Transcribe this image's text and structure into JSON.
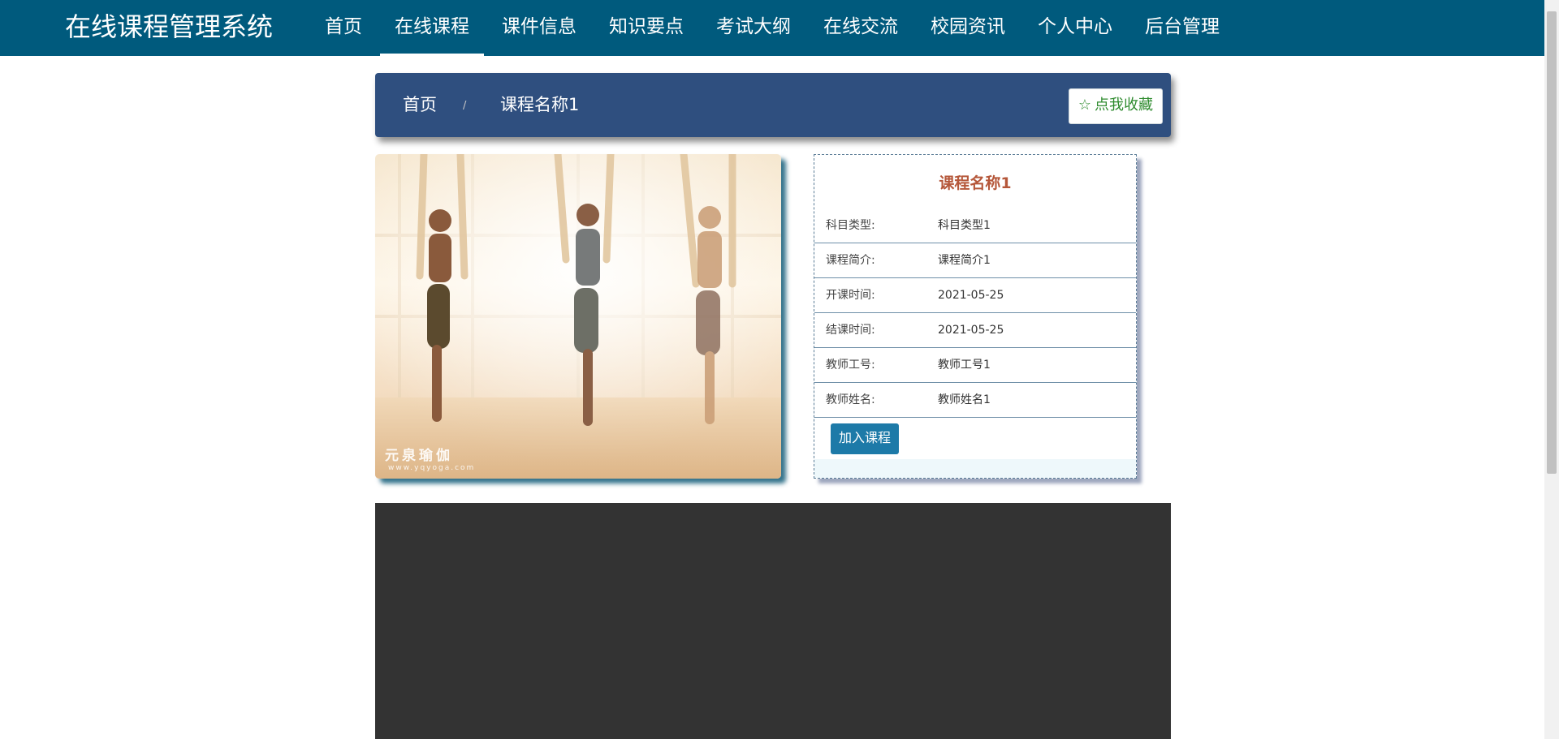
{
  "header": {
    "site_title": "在线课程管理系统",
    "nav": [
      {
        "label": "首页",
        "active": false
      },
      {
        "label": "在线课程",
        "active": true
      },
      {
        "label": "课件信息",
        "active": false
      },
      {
        "label": "知识要点",
        "active": false
      },
      {
        "label": "考试大纲",
        "active": false
      },
      {
        "label": "在线交流",
        "active": false
      },
      {
        "label": "校园资讯",
        "active": false
      },
      {
        "label": "个人中心",
        "active": false
      },
      {
        "label": "后台管理",
        "active": false
      }
    ]
  },
  "breadcrumb": {
    "home": "首页",
    "separator": "/",
    "current": "课程名称1",
    "favorite_label": "点我收藏",
    "favorite_icon": "star-outline-icon"
  },
  "course_image": {
    "watermark": "元泉瑜伽",
    "watermark_sub": "www.yqyoga.com"
  },
  "course": {
    "name": "课程名称1",
    "fields": [
      {
        "label": "科目类型:",
        "value": "科目类型1"
      },
      {
        "label": "课程简介:",
        "value": "课程简介1"
      },
      {
        "label": "开课时间:",
        "value": "2021-05-25"
      },
      {
        "label": "结课时间:",
        "value": "2021-05-25"
      },
      {
        "label": "教师工号:",
        "value": "教师工号1"
      },
      {
        "label": "教师姓名:",
        "value": "教师姓名1"
      }
    ],
    "join_label": "加入课程"
  },
  "colors": {
    "header_bg": "#005a7d",
    "breadcrumb_bg": "#2f4f7f",
    "title_accent": "#b5573a",
    "join_button": "#1d7aa8",
    "favorite_text": "#2e8b2e",
    "video_bg": "#333333"
  }
}
